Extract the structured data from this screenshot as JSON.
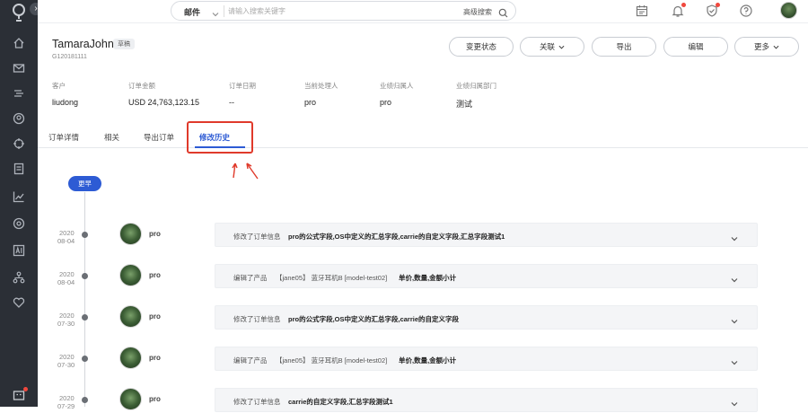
{
  "topbar": {
    "search_scope": "邮件",
    "search_placeholder": "请输入搜索关键字",
    "advanced_search": "高级搜索"
  },
  "record": {
    "title": "TamaraJohn",
    "status": "草稿",
    "order_no": "G120181111"
  },
  "actions": [
    {
      "label": "变更状态"
    },
    {
      "label": "关联"
    },
    {
      "label": "导出"
    },
    {
      "label": "编辑"
    },
    {
      "label": "更多"
    }
  ],
  "info": [
    {
      "label": "客户",
      "value": "liudong"
    },
    {
      "label": "订单金额",
      "value": "USD 24,763,123.15"
    },
    {
      "label": "订单日期",
      "value": "--"
    },
    {
      "label": "当前处理人",
      "value": "pro"
    },
    {
      "label": "业绩归属人",
      "value": "pro"
    },
    {
      "label": "业绩归属部门",
      "value": "测试"
    }
  ],
  "tabs": [
    {
      "label": "订单详情"
    },
    {
      "label": "相关"
    },
    {
      "label": "导出订单"
    },
    {
      "label": "修改历史"
    }
  ],
  "timeline": {
    "earlier_label": "更早",
    "entries": [
      {
        "year": "2020",
        "md": "08-04",
        "user": "pro",
        "action": "修改了订单信息",
        "product": "",
        "detail": "pro的公式字段,OS中定义的汇总字段,carrie的自定义字段,汇总字段测试1"
      },
      {
        "year": "2020",
        "md": "08-04",
        "user": "pro",
        "action": "编辑了产品",
        "product": "【jane05】 蓝牙耳机B [model-test02]",
        "detail": "单价,数量,金额小计"
      },
      {
        "year": "2020",
        "md": "07-30",
        "user": "pro",
        "action": "修改了订单信息",
        "product": "",
        "detail": "pro的公式字段,OS中定义的汇总字段,carrie的自定义字段"
      },
      {
        "year": "2020",
        "md": "07-30",
        "user": "pro",
        "action": "编辑了产品",
        "product": "【jane05】 蓝牙耳机B [model-test02]",
        "detail": "单价,数量,金额小计"
      },
      {
        "year": "2020",
        "md": "07-29",
        "user": "pro",
        "action": "修改了订单信息",
        "product": "",
        "detail": "carrie的自定义字段,汇总字段测试1"
      }
    ]
  },
  "colors": {
    "accent": "#2d5bd4",
    "sidebar": "#2b2f36",
    "annotation": "#e03a2b"
  }
}
